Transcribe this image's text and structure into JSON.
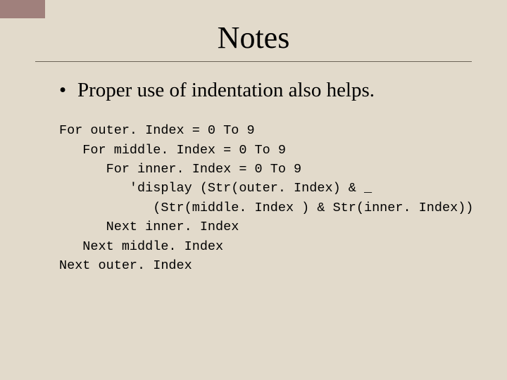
{
  "title": "Notes",
  "bullets": [
    "Proper use of indentation also helps."
  ],
  "code": {
    "l1": "For outer. Index = 0 To 9",
    "l2": "   For middle. Index = 0 To 9",
    "l3": "      For inner. Index = 0 To 9",
    "l4": "         'display (Str(outer. Index) & _",
    "l5": "            (Str(middle. Index ) & Str(inner. Index))",
    "l6": "      Next inner. Index",
    "l7": "   Next middle. Index",
    "l8": "Next outer. Index"
  }
}
